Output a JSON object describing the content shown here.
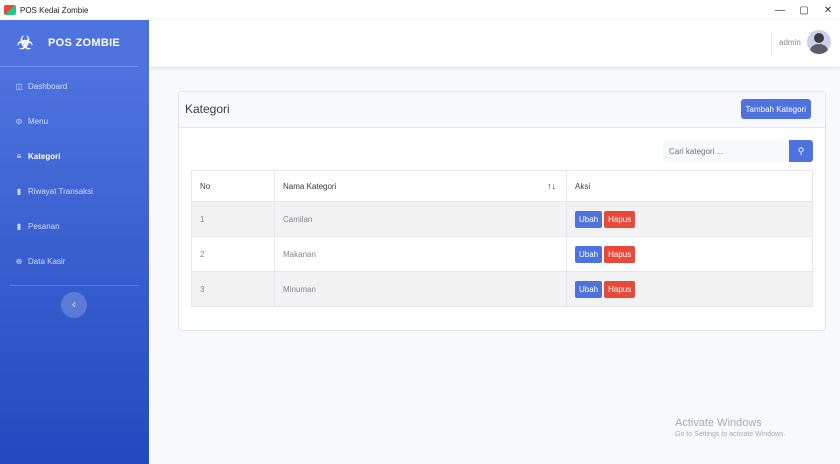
{
  "window": {
    "title": "POS Kedai Zombie",
    "controls": [
      "—",
      "▢",
      "✕"
    ]
  },
  "sidebar": {
    "brand": "POS ZOMBIE",
    "brand_icon": "biohazard-icon",
    "items": [
      {
        "label": "Dashboard",
        "icon": "dashboard-icon",
        "active": false
      },
      {
        "label": "Menu",
        "icon": "menu-icon",
        "active": false
      },
      {
        "label": "Kategori",
        "icon": "list-icon",
        "active": true
      },
      {
        "label": "Riwayat Transaksi",
        "icon": "file-icon",
        "active": false
      },
      {
        "label": "Pesanan",
        "icon": "file-icon",
        "active": false
      },
      {
        "label": "Data Kasir",
        "icon": "user-circle-icon",
        "active": false
      }
    ],
    "toggle_label": "‹"
  },
  "topbar": {
    "username": "admin"
  },
  "card": {
    "title": "Kategori",
    "add_button": "Tambah Kategori",
    "search": {
      "placeholder": "Cari kategori ...",
      "button_icon": "search-icon"
    },
    "table": {
      "headers": [
        "No",
        "Nama Kategori",
        "Aksi"
      ],
      "rows": [
        {
          "no": "1",
          "nama": "Camilan"
        },
        {
          "no": "2",
          "nama": "Makanan"
        },
        {
          "no": "3",
          "nama": "Minuman"
        }
      ],
      "edit_label": "Ubah",
      "delete_label": "Hapus"
    }
  },
  "watermark": {
    "title": "Activate Windows",
    "subtitle": "Go to Settings to activate Windows."
  },
  "colors": {
    "primary": "#4e73df",
    "danger": "#e74a3b",
    "sidebar_dark": "#224abe"
  }
}
